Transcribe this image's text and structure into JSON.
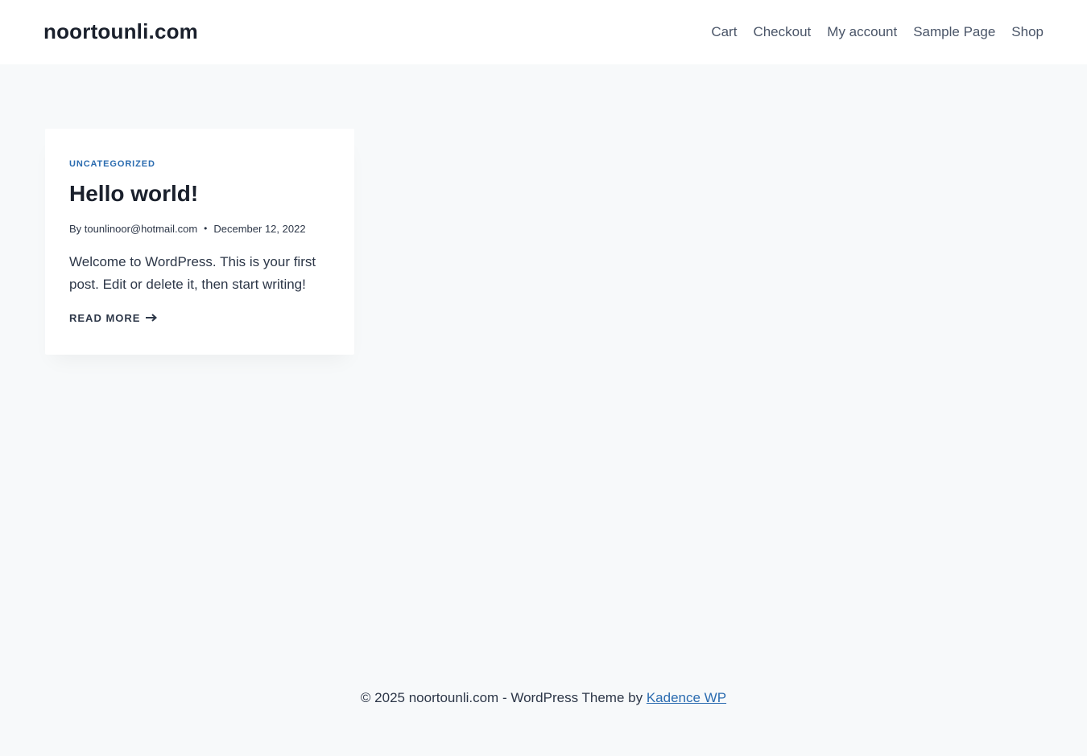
{
  "header": {
    "site_title": "noortounli.com",
    "nav": [
      {
        "label": "Cart"
      },
      {
        "label": "Checkout"
      },
      {
        "label": "My account"
      },
      {
        "label": "Sample Page"
      },
      {
        "label": "Shop"
      }
    ]
  },
  "post": {
    "category": "UNCATEGORIZED",
    "title": "Hello world!",
    "author_prefix": "By",
    "author": "tounlinoor@hotmail.com",
    "separator": "•",
    "date": "December 12, 2022",
    "excerpt": "Welcome to WordPress. This is your first post. Edit or delete it, then start writing!",
    "read_more": "READ MORE",
    "arrow_icon": "arrow-right-icon"
  },
  "footer": {
    "text": "© 2025 noortounli.com - WordPress Theme by ",
    "link_label": "Kadence WP"
  },
  "colors": {
    "accent": "#2b6cb0",
    "background": "#f7f9fa",
    "text": "#2d3748"
  }
}
